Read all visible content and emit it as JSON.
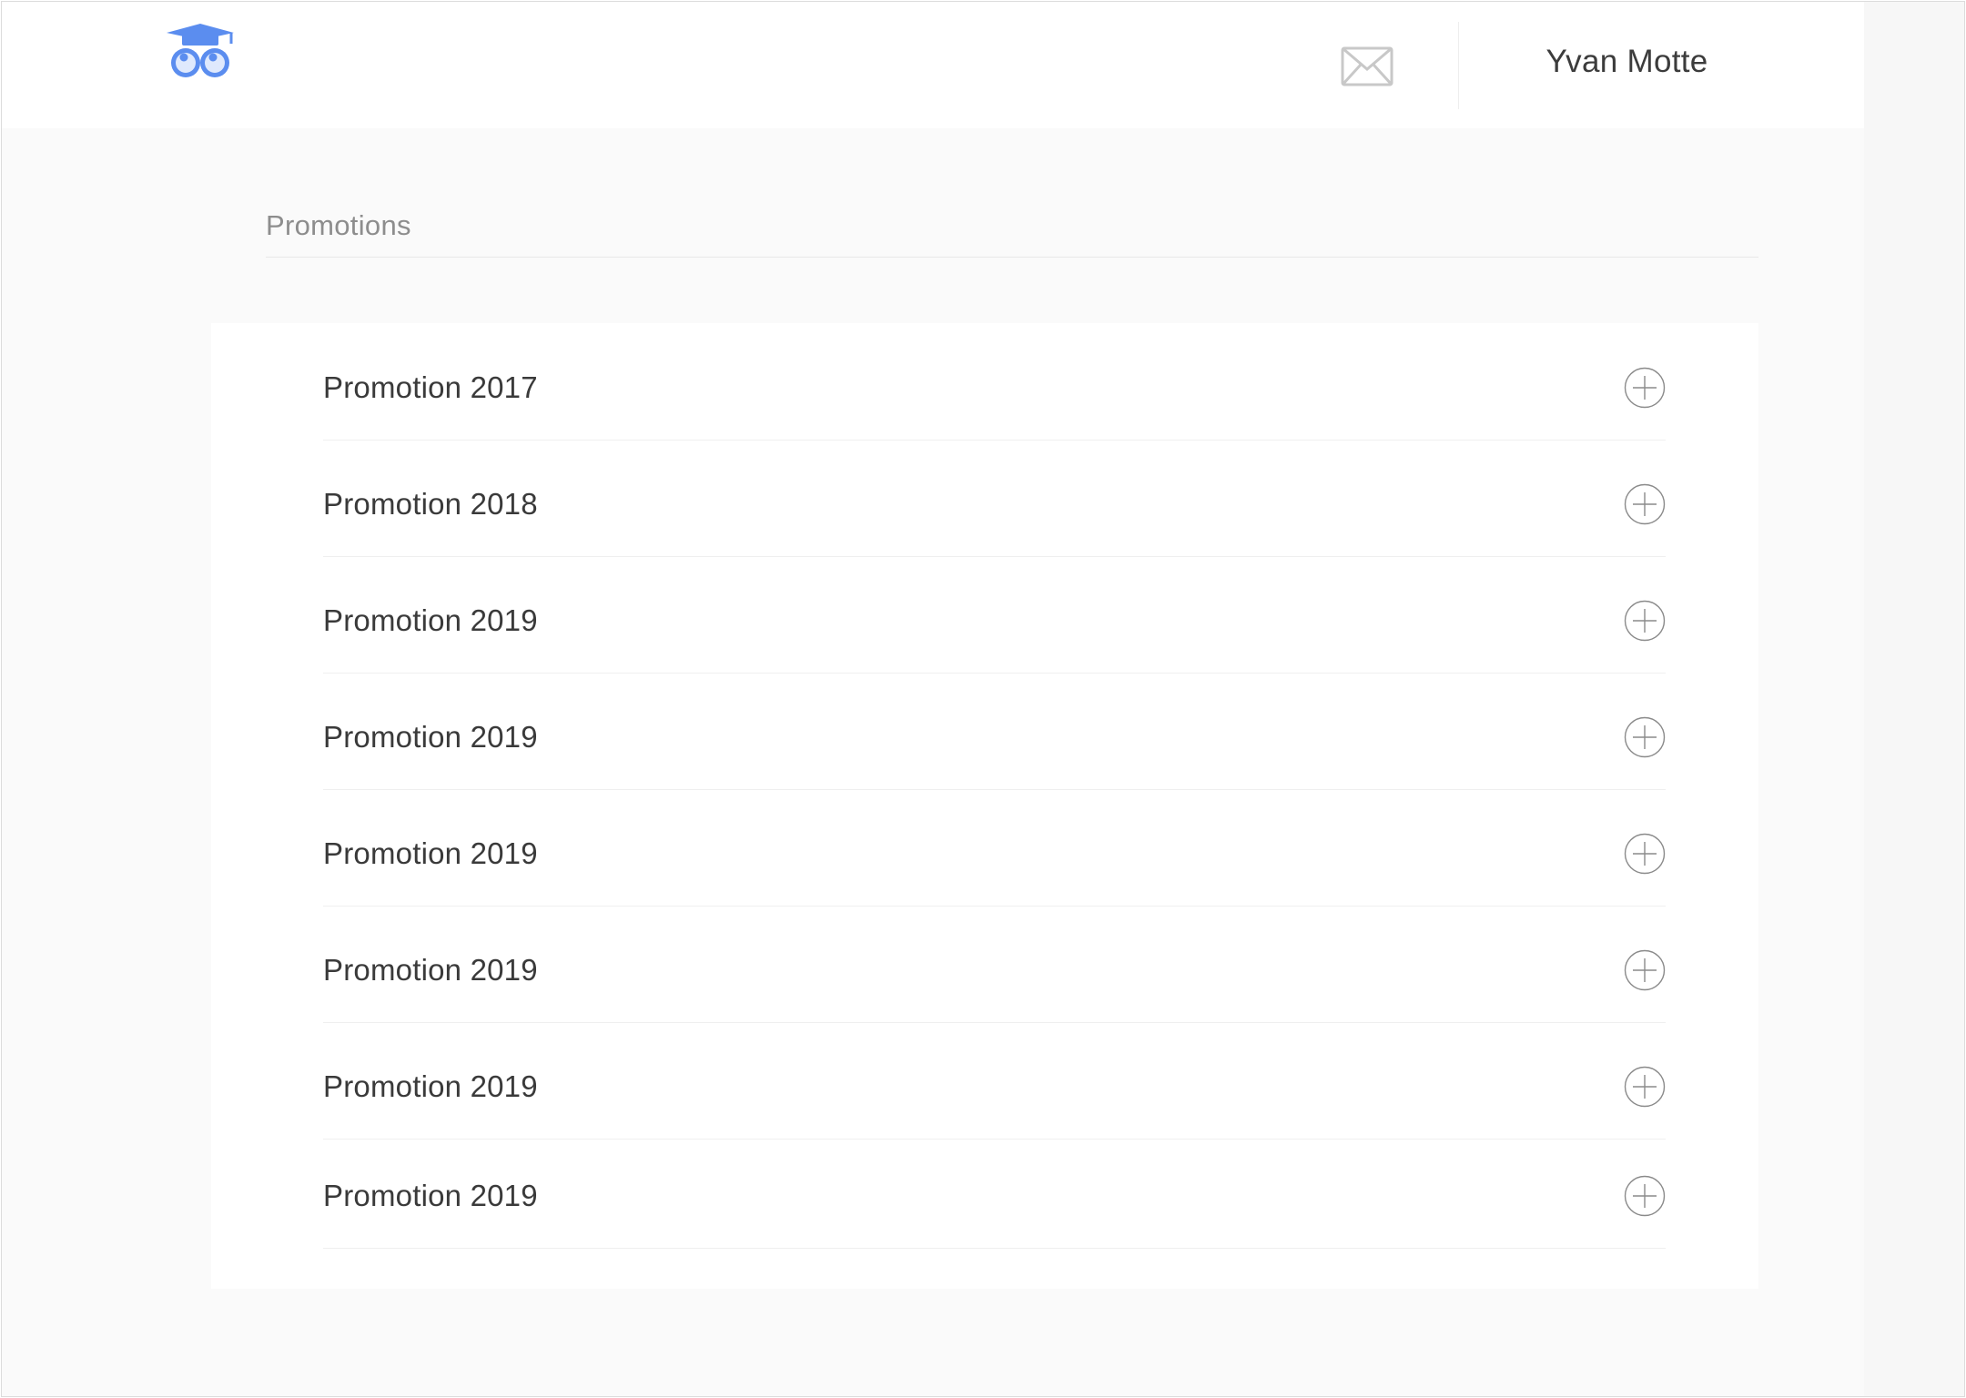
{
  "header": {
    "logo_icon": "graduation-owl-logo-icon",
    "mail_icon": "envelope-icon",
    "user_name": "Yvan Motte"
  },
  "page": {
    "title": "Promotions"
  },
  "promotions": [
    {
      "label": "Promotion 2017",
      "action_icon": "plus-circle-icon"
    },
    {
      "label": "Promotion 2018",
      "action_icon": "plus-circle-icon"
    },
    {
      "label": "Promotion 2019",
      "action_icon": "plus-circle-icon"
    },
    {
      "label": "Promotion 2019",
      "action_icon": "plus-circle-icon"
    },
    {
      "label": "Promotion 2019",
      "action_icon": "plus-circle-icon"
    },
    {
      "label": "Promotion 2019",
      "action_icon": "plus-circle-icon"
    },
    {
      "label": "Promotion 2019",
      "action_icon": "plus-circle-icon"
    },
    {
      "label": "Promotion 2019",
      "action_icon": "plus-circle-icon"
    }
  ],
  "colors": {
    "brand": "#5b8def",
    "background": "#fafafa",
    "text": "#3a3a3a",
    "muted": "#8d8d8d"
  }
}
